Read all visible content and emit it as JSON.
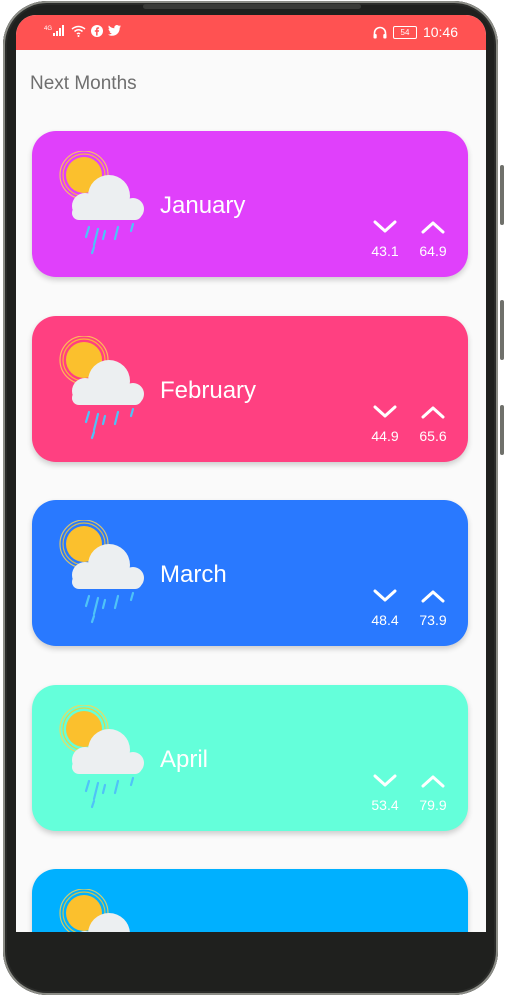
{
  "status_bar": {
    "network_label": "4G",
    "battery": "54",
    "time": "10:46",
    "background": "#ff5252"
  },
  "page_title": "Next Months",
  "cards": [
    {
      "month": "January",
      "low": "43.1",
      "high": "64.9",
      "color": "#e040fb"
    },
    {
      "month": "February",
      "low": "44.9",
      "high": "65.6",
      "color": "#ff4081"
    },
    {
      "month": "March",
      "low": "48.4",
      "high": "73.9",
      "color": "#2979ff"
    },
    {
      "month": "April",
      "low": "53.4",
      "high": "79.9",
      "color": "#64ffda"
    },
    {
      "month": "",
      "low": "",
      "high": "",
      "color": "#00b0ff"
    }
  ],
  "icons": {
    "weather": "sun-cloud-rain-icon",
    "low": "chevron-down-icon",
    "high": "chevron-up-icon"
  }
}
